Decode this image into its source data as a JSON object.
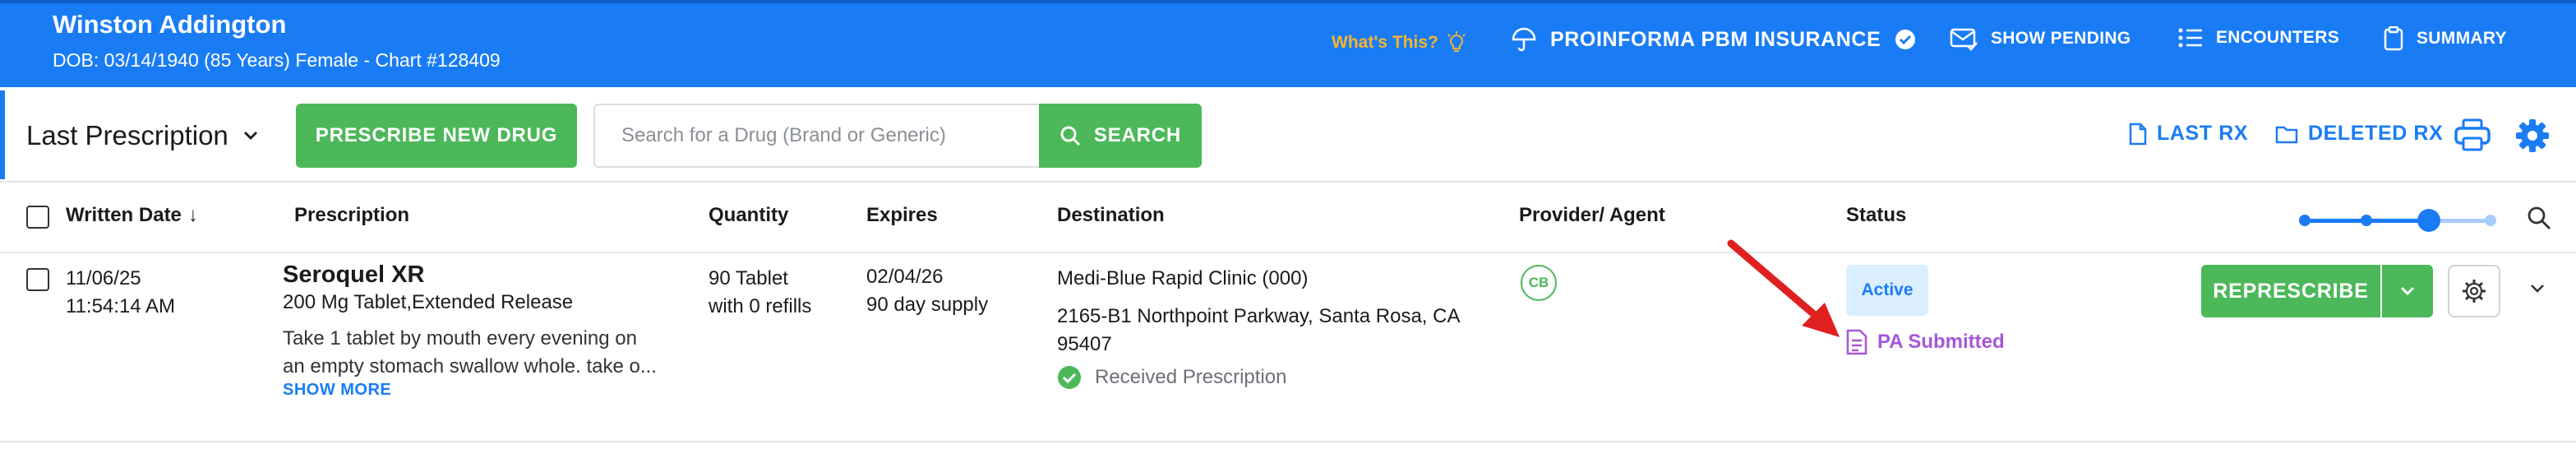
{
  "patient": {
    "name": "Winston Addington",
    "details": "DOB: 03/14/1940 (85 Years) Female - Chart #128409"
  },
  "header_nav": {
    "whats_this": "What's This?",
    "insurance": "PROINFORMA PBM INSURANCE",
    "show_pending": "SHOW PENDING",
    "encounters": "ENCOUNTERS",
    "summary": "SUMMARY"
  },
  "toolbar": {
    "title": "Last Prescription",
    "prescribe_label": "PRESCRIBE NEW DRUG",
    "search_placeholder": "Search for a Drug (Brand or Generic)",
    "search_label": "SEARCH",
    "last_rx_label": "LAST RX",
    "deleted_rx_label": "DELETED RX"
  },
  "columns": {
    "written_date": "Written Date",
    "written_date_sort": "↓",
    "prescription": "Prescription",
    "quantity": "Quantity",
    "expires": "Expires",
    "destination": "Destination",
    "provider": "Provider/ Agent",
    "status": "Status"
  },
  "density_slider": {
    "steps": 4,
    "selected_index": 2
  },
  "rows": [
    {
      "date": "11/06/25",
      "time": "11:54:14 AM",
      "drug_name": "Seroquel XR",
      "drug_form": "200 Mg Tablet,Extended Release",
      "sig_line1": "Take 1 tablet by mouth every evening on",
      "sig_line2": "an empty stomach swallow whole. take o...",
      "show_more": "SHOW MORE",
      "qty_line1": "90 Tablet",
      "qty_line2": "with 0 refills",
      "expires_date": "02/04/26",
      "expires_supply": "90 day supply",
      "dest_name": "Medi-Blue Rapid Clinic (000)",
      "dest_addr1": "2165-B1 Northpoint Parkway, Santa Rosa, CA",
      "dest_addr2": "95407",
      "dest_status": "Received Prescription",
      "provider_initials": "CB",
      "status": "Active",
      "pa_status": "PA Submitted",
      "represcribe_label": "REPRESCRIBE"
    }
  ],
  "colors": {
    "brand_blue": "#1a7cf5",
    "green": "#4cb85a",
    "warning_yellow": "#f7b52c",
    "pa_purple": "#a657d6",
    "annotation_red": "#e02020"
  }
}
